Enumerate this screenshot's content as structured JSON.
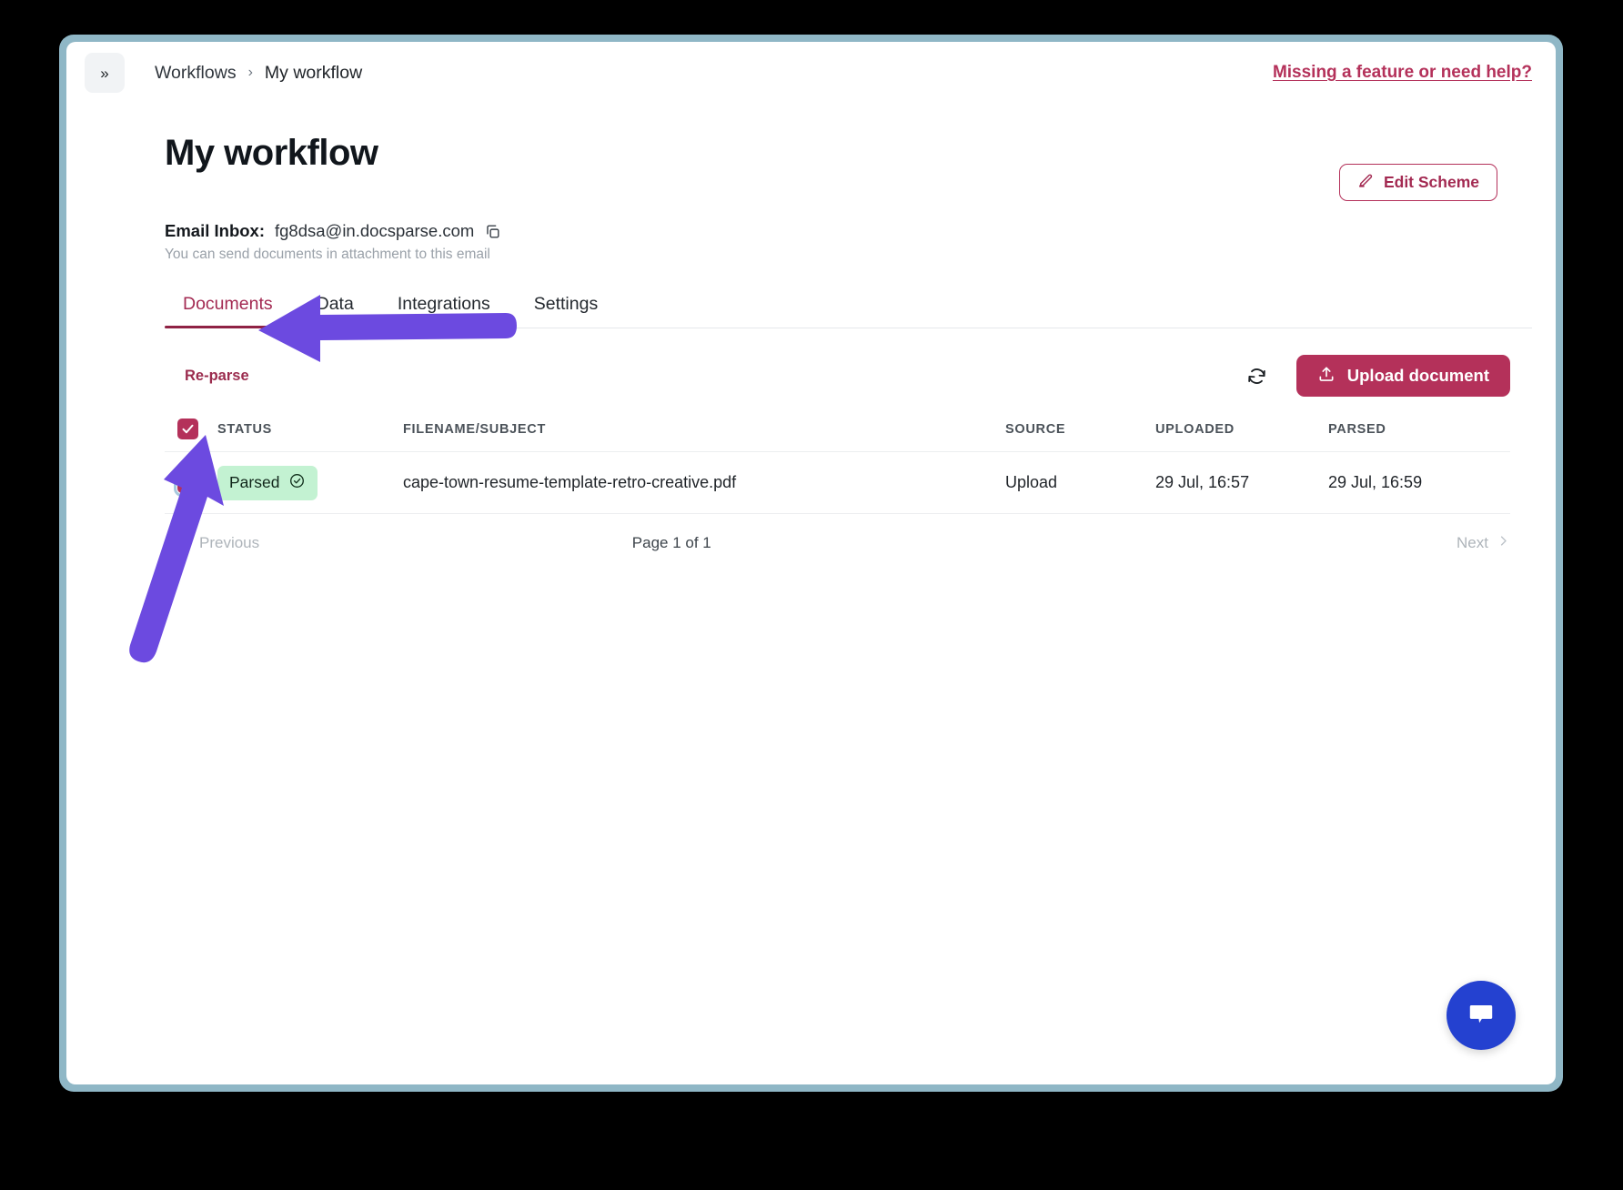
{
  "window": {
    "frame_color": "#8fb7c6",
    "background": "#ffffff"
  },
  "topbar": {
    "collapse_icon": "chevrons-right-icon",
    "collapse_glyph": "»",
    "breadcrumb": {
      "root": "Workflows",
      "separator": "›",
      "current": "My workflow"
    },
    "help_link": "Missing a feature or need help?"
  },
  "header": {
    "title": "My workflow",
    "edit_scheme_label": "Edit Scheme",
    "edit_scheme_icon": "pencil-icon",
    "email_label": "Email Inbox:",
    "email_value": "fg8dsa@in.docsparse.com",
    "copy_icon": "copy-icon",
    "email_hint": "You can send documents in attachment to this email"
  },
  "tabs": [
    {
      "label": "Documents",
      "active": true
    },
    {
      "label": "Data",
      "active": false
    },
    {
      "label": "Integrations",
      "active": false
    },
    {
      "label": "Settings",
      "active": false
    }
  ],
  "toolbar": {
    "reparse_label": "Re-parse",
    "refresh_icon": "refresh-icon",
    "upload_label": "Upload document",
    "upload_icon": "upload-icon"
  },
  "table": {
    "select_all_checked": true,
    "columns": [
      "STATUS",
      "FILENAME/SUBJECT",
      "SOURCE",
      "UPLOADED",
      "PARSED"
    ],
    "rows": [
      {
        "checked": true,
        "status": "Parsed",
        "status_icon": "check-circle-icon",
        "filename": "cape-town-resume-template-retro-creative.pdf",
        "source": "Upload",
        "uploaded": "29 Jul, 16:57",
        "parsed": "29 Jul, 16:59"
      }
    ]
  },
  "pagination": {
    "previous_label": "Previous",
    "page_info": "Page 1 of 1",
    "next_label": "Next",
    "prev_icon": "chevron-left-icon",
    "next_icon": "chevron-right-icon"
  },
  "chat_widget": {
    "icon": "chat-bubble-icon",
    "color": "#2441d0"
  },
  "annotations": {
    "arrow_color": "#6c4ae0",
    "arrow_reparse_target": "Re-parse",
    "arrow_checkbox_target": "row-checkbox"
  },
  "colors": {
    "accent": "#b4315a",
    "accent_dark": "#8f2244",
    "status_badge_bg": "#c3f2d2",
    "frame": "#8fb7c6",
    "annotation": "#6c4ae0"
  }
}
